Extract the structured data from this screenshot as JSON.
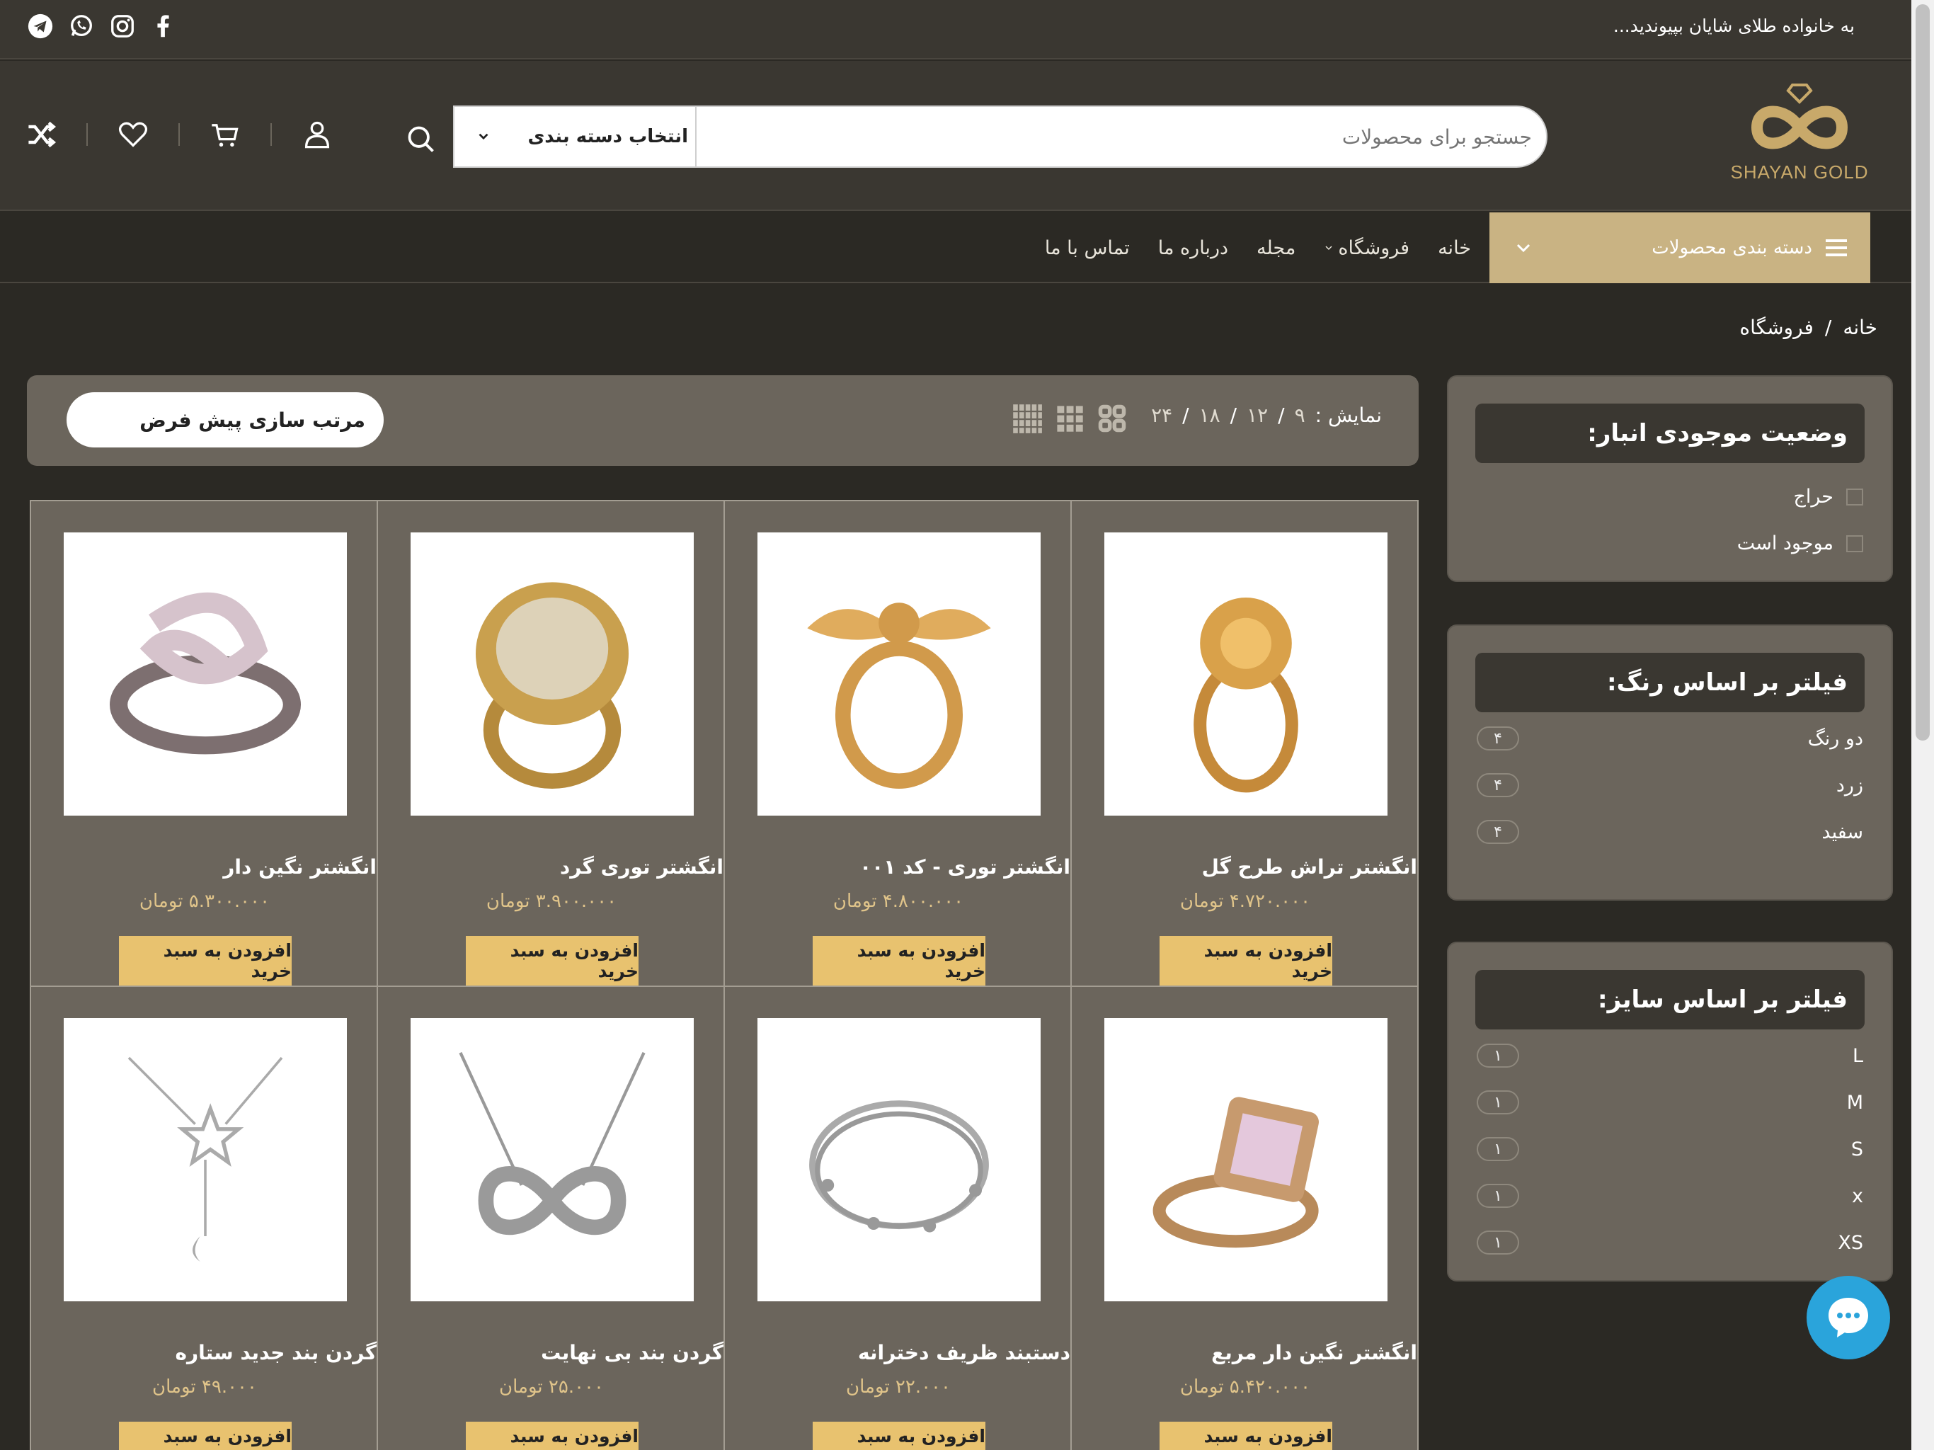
{
  "topbar": {
    "welcome": "به خانواده طلای شایان بپیوندید..."
  },
  "header": {
    "logo_text": "SHAYAN GOLD",
    "search_placeholder": "جستجو برای محصولات",
    "category_select": "انتخاب دسته بندی"
  },
  "nav": {
    "categories_label": "دسته بندی محصولات",
    "links": [
      "خانه",
      "فروشگاه",
      "مجله",
      "درباره ما",
      "تماس با ما"
    ]
  },
  "breadcrumb": {
    "home": "خانه",
    "separator": "/",
    "current": "فروشگاه"
  },
  "sidebar": {
    "stock": {
      "title": "وضعیت موجودی انبار:",
      "options": [
        "حراج",
        "موجود است"
      ]
    },
    "color": {
      "title": "فیلتر بر اساس رنگ:",
      "items": [
        {
          "label": "دو رنگ",
          "count": "۴"
        },
        {
          "label": "زرد",
          "count": "۴"
        },
        {
          "label": "سفید",
          "count": "۴"
        }
      ]
    },
    "size": {
      "title": "فیلتر بر اساس سایز:",
      "items": [
        {
          "label": "L",
          "count": "۱"
        },
        {
          "label": "M",
          "count": "۱"
        },
        {
          "label": "S",
          "count": "۱"
        },
        {
          "label": "x",
          "count": "۱"
        },
        {
          "label": "XS",
          "count": "۱"
        }
      ]
    }
  },
  "toolbar": {
    "show_label": "نمایش :",
    "per_page": [
      "۹",
      "۱۲",
      "۱۸",
      "۲۴"
    ],
    "sort_label": "مرتب سازی پیش فرض"
  },
  "products": [
    {
      "name": "انگشتر تراش طرح گل",
      "price": "۴.۷۲۰.۰۰۰ تومان",
      "add": "افزودن به سبد خرید",
      "icon": "ring-flower-icon"
    },
    {
      "name": "انگشتر توری - کد ۰۰۱",
      "price": "۴.۸۰۰.۰۰۰ تومان",
      "add": "افزودن به سبد خرید",
      "icon": "ring-bow-icon"
    },
    {
      "name": "انگشتر توری گرد",
      "price": "۳.۹۰۰.۰۰۰ تومان",
      "add": "افزودن به سبد خرید",
      "icon": "ring-dome-icon"
    },
    {
      "name": "انگشتر نگین دار",
      "price": "۵.۳۰۰.۰۰۰ تومان",
      "add": "افزودن به سبد خرید",
      "icon": "ring-silver-icon"
    },
    {
      "name": "انگشتر نگین دار مربع",
      "price": "۵.۴۲۰.۰۰۰ تومان",
      "add": "افزودن به سبد خرید",
      "icon": "ring-square-icon"
    },
    {
      "name": "دستبند ظریف دخترانه",
      "price": "۲۲.۰۰۰ تومان",
      "add": "افزودن به سبد خرید",
      "icon": "bracelet-icon"
    },
    {
      "name": "گردن بند بی نهایت",
      "price": "۲۵.۰۰۰ تومان",
      "add": "افزودن به سبد خرید",
      "icon": "necklace-infinity-icon"
    },
    {
      "name": "گردن بند جدید ستاره",
      "price": "۴۹.۰۰۰ تومان",
      "add": "افزودن به سبد خرید",
      "icon": "necklace-star-icon"
    }
  ],
  "colors": {
    "background": "#2b2924",
    "panel": "#6b655c",
    "accent_gold": "#c9b383",
    "button_gold": "#e8c26f",
    "price": "#e0c48a"
  }
}
